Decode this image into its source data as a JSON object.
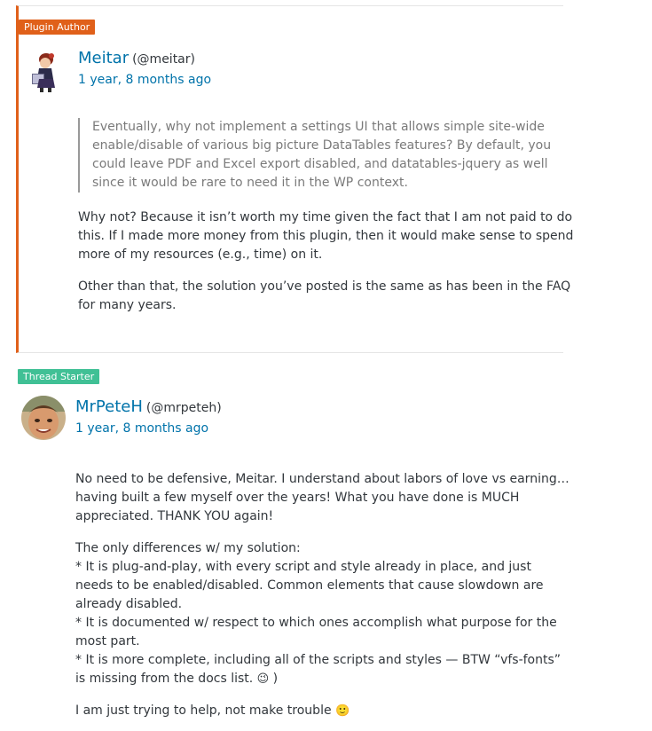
{
  "reply1": {
    "badge": "Plugin Author",
    "author_name": "Meitar",
    "author_handle": "(@meitar)",
    "date": "1 year, 8 months ago",
    "quote": "Eventually, why not implement a settings UI that allows simple site-wide enable/disable of various big picture DataTables features? By default, you could leave PDF and Excel export disabled, and datatables-jquery as well since it would be rare to need it in the WP context.",
    "paragraphs": [
      "Why not? Because it isn’t worth my time given the fact that I am not paid to do this. If I made more money from this plugin, then it would make sense to spend more of my resources (e.g., time) on it.",
      "Other than that, the solution you’ve posted is the same as has been in the FAQ for many years."
    ],
    "accent_color": "#e0601a"
  },
  "reply2": {
    "badge": "Thread Starter",
    "author_name": "MrPeteH",
    "author_handle": "(@mrpeteh)",
    "date": "1 year, 8 months ago",
    "p1": "No need to be defensive, Meitar. I understand about labors of love vs earning… having built a few myself over the years! What you have done is MUCH appreciated. THANK YOU again!",
    "p2_lines": [
      "The only differences w/ my solution:",
      "* It is plug-and-play, with every script and style already in place, and just needs to be enabled/disabled. Common elements that cause slowdown are already disabled.",
      "* It is documented w/ respect to which ones accomplish what purpose for the most part.",
      "* It is more complete, including all of the scripts and styles — BTW “vfs-fonts” is missing from the docs list."
    ],
    "p2_tail": " )",
    "p3": "I am just trying to help, not make trouble",
    "wink_emoji": "😉",
    "smile_emoji": "🙂",
    "accent_color": "#40c095"
  }
}
